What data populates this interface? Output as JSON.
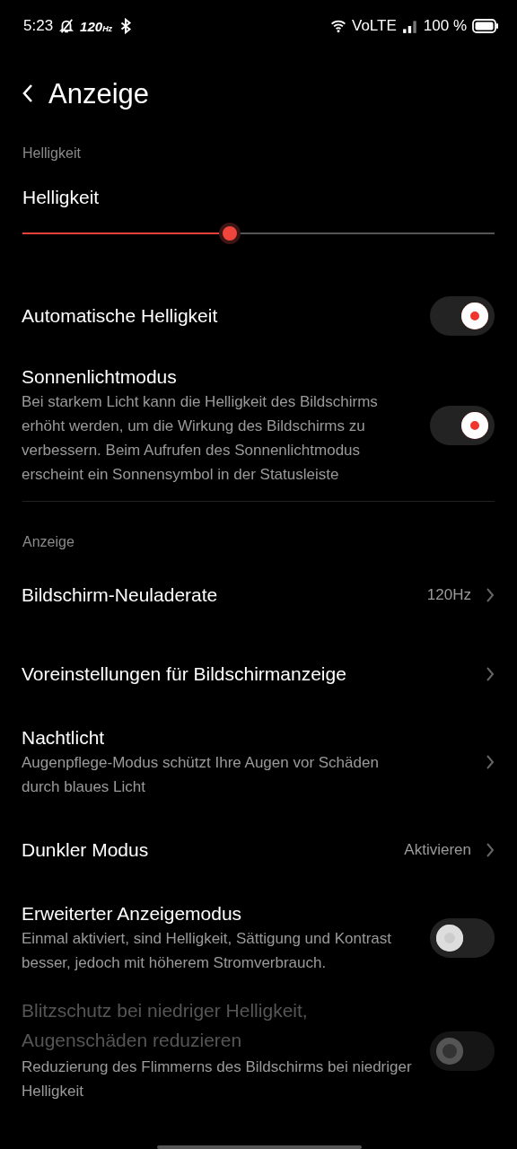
{
  "status_bar": {
    "time": "5:23",
    "refresh": "120$_{Hz}$",
    "network": "VoLTE",
    "battery": "100 %"
  },
  "header": {
    "title": "Anzeige"
  },
  "sections": [
    {
      "label": "Helligkeit",
      "items": [
        {
          "kind": "slider",
          "title": "Helligkeit",
          "level": 0.44
        },
        {
          "kind": "toggle",
          "title": "Automatische Helligkeit",
          "on": true,
          "disabled": false
        },
        {
          "kind": "toggle",
          "title": "Sonnenlichtmodus",
          "description": "Bei starkem Licht kann die Helligkeit des Bildschirms erhöht werden, um die Wirkung des Bildschirms zu verbessern. Beim Aufrufen des Sonnenlichtmodus erscheint ein Sonnensymbol in der Statusleiste",
          "on": true,
          "disabled": false
        }
      ]
    },
    {
      "label": "Anzeige",
      "items": [
        {
          "kind": "link",
          "title": "Bildschirm-Neuladerate",
          "value": "120Hz"
        },
        {
          "kind": "link",
          "title": "Voreinstellungen für Bildschirmanzeige"
        },
        {
          "kind": "link",
          "title": "Nachtlicht",
          "description": "Augenpflege-Modus schützt Ihre Augen vor Schäden durch blaues Licht"
        },
        {
          "kind": "link",
          "title": "Dunkler Modus",
          "value": "Aktivieren"
        },
        {
          "kind": "toggle",
          "title": "Erweiterter Anzeigemodus",
          "description": "Einmal aktiviert, sind Helligkeit, Sättigung und Kontrast besser, jedoch mit höherem Stromverbrauch.",
          "on": false,
          "disabled": false
        },
        {
          "kind": "toggle",
          "title": "Blitzschutz bei niedriger Helligkeit, Augenschäden reduzieren",
          "description": "Reduzierung des Flimmerns des Bildschirms bei niedriger Helligkeit",
          "on": false,
          "disabled": true
        }
      ]
    }
  ]
}
